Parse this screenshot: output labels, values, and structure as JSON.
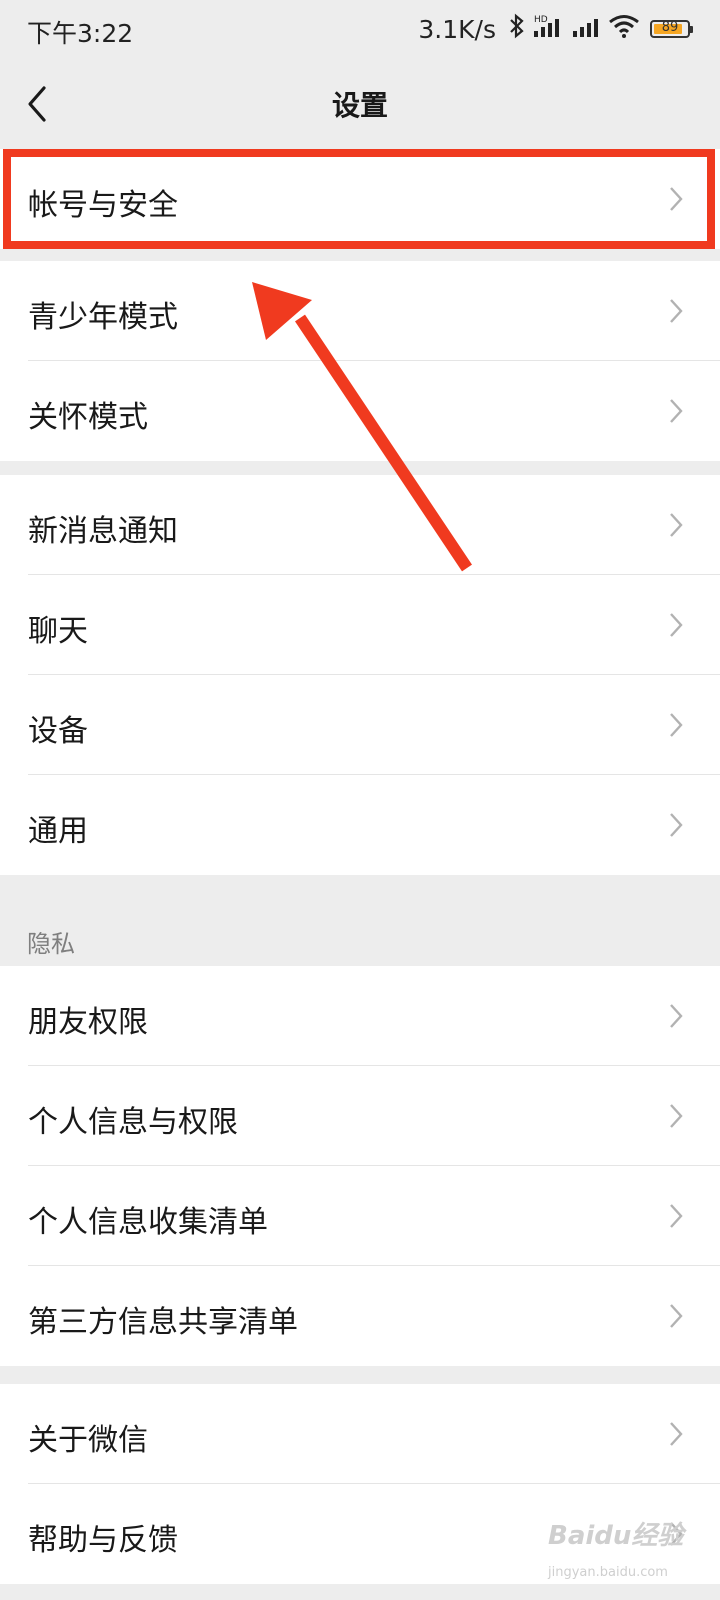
{
  "status_bar": {
    "time": "下午3:22",
    "net_speed": "3.1K/s",
    "signal_badge": "HD",
    "battery": "89",
    "battery_level": 0.89,
    "icons": [
      "bluetooth-icon",
      "signal-icon",
      "signal-icon",
      "wifi-icon",
      "battery-icon"
    ]
  },
  "nav": {
    "title": "设置",
    "back_icon": "chevron-left-icon"
  },
  "groups": [
    {
      "items": [
        {
          "label": "帐号与安全"
        }
      ]
    },
    {
      "items": [
        {
          "label": "青少年模式"
        },
        {
          "label": "关怀模式"
        }
      ]
    },
    {
      "items": [
        {
          "label": "新消息通知"
        },
        {
          "label": "聊天"
        },
        {
          "label": "设备"
        },
        {
          "label": "通用"
        }
      ]
    },
    {
      "header": "隐私",
      "items": [
        {
          "label": "朋友权限"
        },
        {
          "label": "个人信息与权限"
        },
        {
          "label": "个人信息收集清单"
        },
        {
          "label": "第三方信息共享清单"
        }
      ]
    },
    {
      "items": [
        {
          "label": "关于微信"
        },
        {
          "label": "帮助与反馈"
        }
      ]
    }
  ],
  "annotation": {
    "color": "#f03a1f"
  },
  "watermark": {
    "text": "Baidu经验",
    "sub": "jingyan.baidu.com"
  },
  "colors": {
    "background": "#ededed",
    "row": "#ffffff",
    "text": "#191919",
    "chevron": "#b2b2b2",
    "accent": "#f03a1f"
  }
}
